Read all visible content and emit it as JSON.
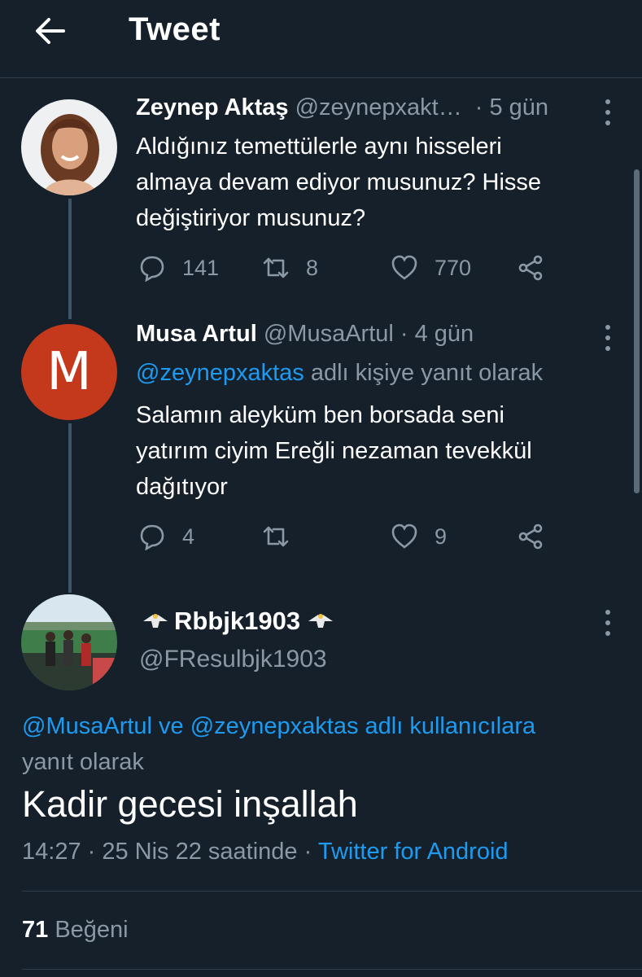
{
  "header": {
    "title": "Tweet"
  },
  "tweets": [
    {
      "name": "Zeynep Aktaş",
      "handle": "@zeynepxakt…",
      "time": "· 5 gün",
      "text_lines": [
        "Aldığınız temettülerle aynı hisseleri",
        "almaya devam ediyor musunuz? Hisse",
        "değiştiriyor musunuz?"
      ],
      "replies": "141",
      "retweets": "8",
      "likes": "770"
    },
    {
      "name": "Musa Artul",
      "handle": "@MusaArtul",
      "time": "· 4 gün",
      "avatar_letter": "M",
      "reply_to": "@zeynepxaktas",
      "reply_suffix": "adlı kişiye yanıt olarak",
      "text_lines": [
        "Salamın aleyküm ben borsada seni",
        "yatırım ciyim Ereğli nezaman tevekkül",
        "dağıtıyor"
      ],
      "replies": "4",
      "retweets": "",
      "likes": "9"
    }
  ],
  "main_tweet": {
    "name": "Rbbjk1903",
    "handle": "@FResulbjk1903",
    "reply_mentions": "@MusaArtul ve @zeynepxaktas adlı kullanıcılara",
    "reply_suffix": "yanıt olarak",
    "text": "Kadir gecesi inşallah",
    "timestamp": "14:27 · 25 Nis 22 saatinde ·",
    "source": "Twitter for Android",
    "like_count": "71",
    "like_label": "Beğeni"
  },
  "colors": {
    "background": "#15202b",
    "accent": "#1d9bf0",
    "muted": "#8b98a5",
    "avatar_m": "#c4381c"
  }
}
